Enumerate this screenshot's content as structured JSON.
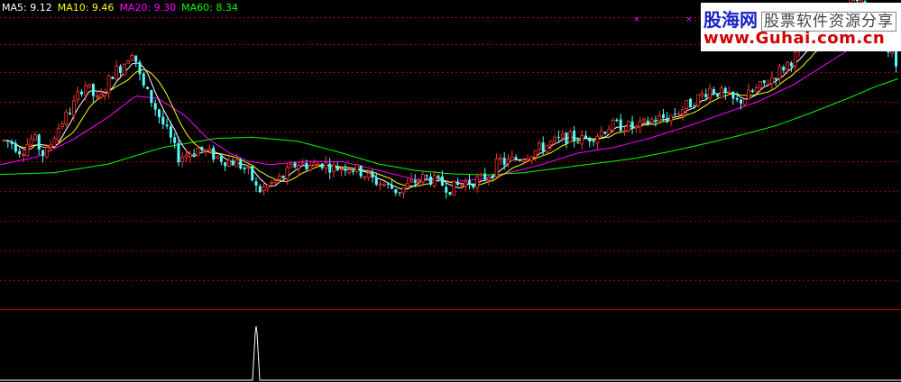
{
  "legend": [
    {
      "label": "MA5:",
      "value": "9.12",
      "color": "#ffffff"
    },
    {
      "label": "MA10:",
      "value": "9.46",
      "color": "#ffff00"
    },
    {
      "label": "MA20:",
      "value": "9.30",
      "color": "#ff00ff"
    },
    {
      "label": "MA60:",
      "value": "8.34",
      "color": "#00ff00"
    }
  ],
  "watermark": {
    "brand": "股海网",
    "tagline": "股票软件资源分享",
    "url": "www.Guhai.com.cn"
  },
  "colors": {
    "background": "#000000",
    "up": "#ff3333",
    "down": "#54fcfc",
    "grid": "#a00000",
    "separator": "#b00000",
    "ma5": "#ffffff",
    "ma10": "#ffff00",
    "ma20": "#ff00ff",
    "ma60": "#00ff00",
    "indicator": "#ffffff"
  },
  "chart_data": {
    "type": "line",
    "description_series": [
      "price",
      "MA5",
      "MA10",
      "MA20",
      "MA60",
      "indicator"
    ],
    "ylim": [
      5.6,
      10.8
    ],
    "price_knots": [
      [
        0,
        8.35
      ],
      [
        12,
        8.3
      ],
      [
        22,
        8.15
      ],
      [
        35,
        8.4
      ],
      [
        48,
        8.05
      ],
      [
        62,
        8.55
      ],
      [
        78,
        8.9
      ],
      [
        92,
        9.35
      ],
      [
        108,
        9.0
      ],
      [
        122,
        9.5
      ],
      [
        134,
        9.65
      ],
      [
        146,
        9.95
      ],
      [
        155,
        9.35
      ],
      [
        168,
        9.0
      ],
      [
        180,
        8.6
      ],
      [
        188,
        8.35
      ],
      [
        196,
        8.05
      ],
      [
        205,
        8.1
      ],
      [
        218,
        8.2
      ],
      [
        232,
        8.1
      ],
      [
        248,
        8.0
      ],
      [
        262,
        7.95
      ],
      [
        276,
        7.75
      ],
      [
        284,
        7.45
      ],
      [
        296,
        7.55
      ],
      [
        312,
        7.7
      ],
      [
        328,
        7.95
      ],
      [
        342,
        7.9
      ],
      [
        356,
        7.95
      ],
      [
        370,
        7.85
      ],
      [
        384,
        7.9
      ],
      [
        398,
        7.8
      ],
      [
        412,
        7.65
      ],
      [
        428,
        7.55
      ],
      [
        440,
        7.45
      ],
      [
        455,
        7.6
      ],
      [
        470,
        7.7
      ],
      [
        486,
        7.6
      ],
      [
        498,
        7.5
      ],
      [
        514,
        7.6
      ],
      [
        530,
        7.65
      ],
      [
        545,
        7.8
      ],
      [
        552,
        8.0
      ],
      [
        560,
        7.95
      ],
      [
        575,
        8.05
      ],
      [
        590,
        8.15
      ],
      [
        610,
        8.3
      ],
      [
        628,
        8.4
      ],
      [
        645,
        8.35
      ],
      [
        660,
        8.45
      ],
      [
        675,
        8.6
      ],
      [
        690,
        8.6
      ],
      [
        705,
        8.55
      ],
      [
        720,
        8.7
      ],
      [
        740,
        8.75
      ],
      [
        755,
        8.9
      ],
      [
        770,
        9.05
      ],
      [
        785,
        9.25
      ],
      [
        800,
        9.15
      ],
      [
        815,
        9.0
      ],
      [
        830,
        9.15
      ],
      [
        848,
        9.35
      ],
      [
        862,
        9.55
      ],
      [
        876,
        9.75
      ],
      [
        890,
        9.95
      ],
      [
        905,
        10.2
      ],
      [
        918,
        10.25
      ],
      [
        930,
        10.4
      ],
      [
        942,
        10.7
      ],
      [
        955,
        10.75
      ],
      [
        965,
        10.45
      ],
      [
        975,
        10.2
      ],
      [
        985,
        9.9
      ],
      [
        993,
        9.7
      ]
    ],
    "ma20_knots": [
      [
        0,
        7.92
      ],
      [
        40,
        8.05
      ],
      [
        80,
        8.35
      ],
      [
        120,
        8.75
      ],
      [
        150,
        9.12
      ],
      [
        175,
        9.08
      ],
      [
        205,
        8.78
      ],
      [
        230,
        8.38
      ],
      [
        255,
        8.12
      ],
      [
        275,
        7.98
      ],
      [
        300,
        7.92
      ],
      [
        340,
        7.98
      ],
      [
        380,
        7.97
      ],
      [
        420,
        7.82
      ],
      [
        460,
        7.66
      ],
      [
        500,
        7.62
      ],
      [
        535,
        7.67
      ],
      [
        560,
        7.76
      ],
      [
        600,
        7.92
      ],
      [
        640,
        8.12
      ],
      [
        680,
        8.22
      ],
      [
        720,
        8.38
      ],
      [
        760,
        8.58
      ],
      [
        800,
        8.8
      ],
      [
        840,
        9.02
      ],
      [
        880,
        9.32
      ],
      [
        920,
        9.72
      ],
      [
        950,
        10.02
      ],
      [
        975,
        10.12
      ],
      [
        995,
        10.02
      ]
    ],
    "ma60_knots": [
      [
        0,
        7.75
      ],
      [
        60,
        7.78
      ],
      [
        120,
        7.93
      ],
      [
        180,
        8.22
      ],
      [
        240,
        8.38
      ],
      [
        280,
        8.4
      ],
      [
        330,
        8.33
      ],
      [
        380,
        8.12
      ],
      [
        420,
        7.93
      ],
      [
        460,
        7.82
      ],
      [
        500,
        7.76
      ],
      [
        540,
        7.74
      ],
      [
        580,
        7.78
      ],
      [
        620,
        7.86
      ],
      [
        660,
        7.94
      ],
      [
        700,
        8.02
      ],
      [
        740,
        8.14
      ],
      [
        780,
        8.28
      ],
      [
        820,
        8.43
      ],
      [
        860,
        8.6
      ],
      [
        900,
        8.83
      ],
      [
        940,
        9.08
      ],
      [
        970,
        9.28
      ],
      [
        995,
        9.42
      ]
    ],
    "indicator": {
      "x": 284,
      "peak": 1,
      "width": 8
    }
  }
}
